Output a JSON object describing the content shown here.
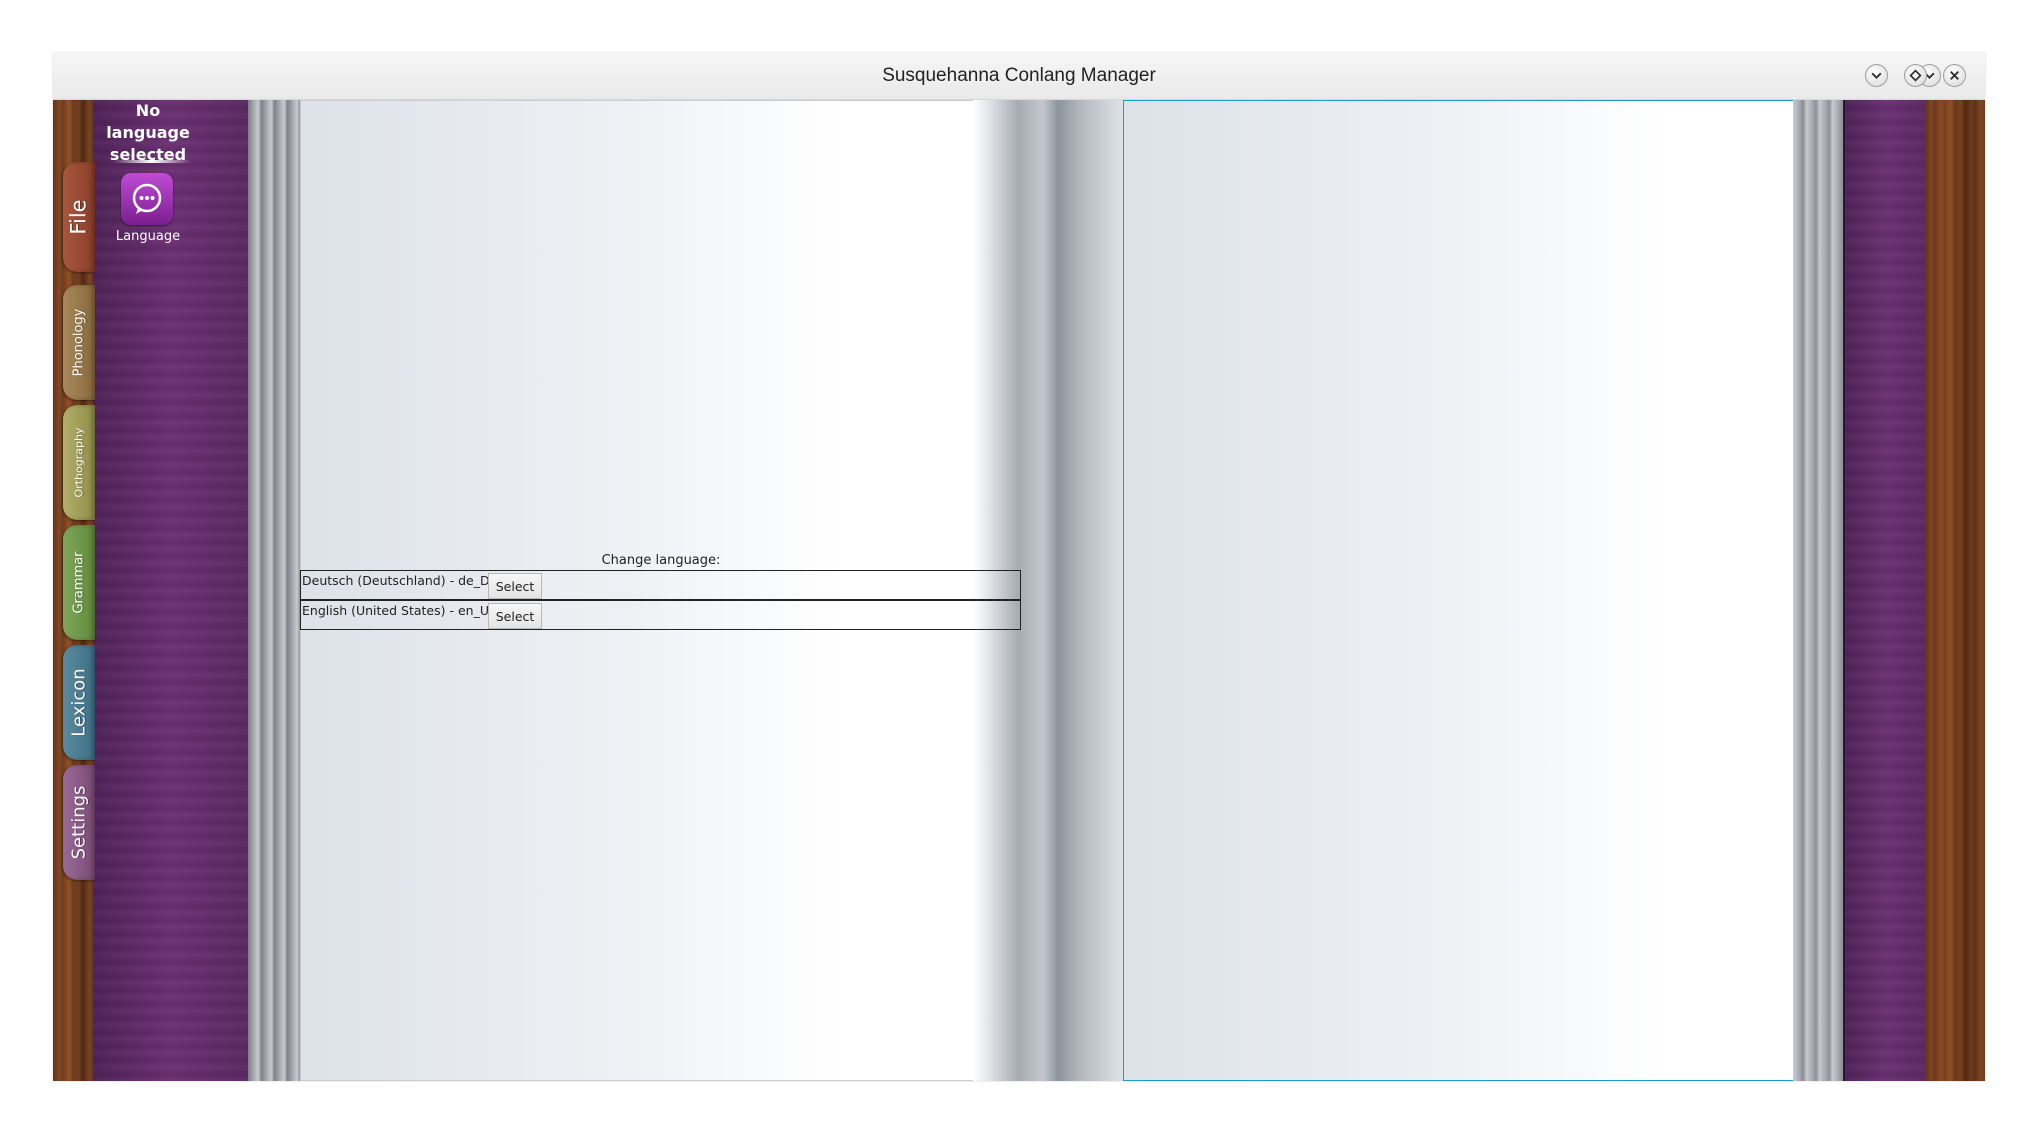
{
  "window": {
    "title": "Susquehanna Conlang Manager",
    "controls": [
      "minimize-icon",
      "maximize-icon",
      "close-icon"
    ]
  },
  "sidebar": {
    "status": "No language selected",
    "status_line1": "No language",
    "status_line2": "selected",
    "language_button_icon": "chat-bubble-icon",
    "language_button_label": "Language",
    "tabs": [
      {
        "label": "File",
        "color": "#a8573e"
      },
      {
        "label": "Phonology",
        "color": "#a98a5d"
      },
      {
        "label": "Orthography",
        "color": "#b2b06a"
      },
      {
        "label": "Grammar",
        "color": "#80a65a"
      },
      {
        "label": "Lexicon",
        "color": "#5b8ba0"
      },
      {
        "label": "Settings",
        "color": "#9a6a96"
      }
    ]
  },
  "left_page": {
    "change_language_label": "Change language:",
    "languages": [
      {
        "name": "Deutsch (Deutschland) - de_DE",
        "button": "Select"
      },
      {
        "name": "English (United States) - en_US",
        "button": "Select"
      }
    ]
  },
  "colors": {
    "cover": "#6a2f72",
    "right_page_border": "#1a9bd1",
    "language_icon": "#9a35b0"
  }
}
